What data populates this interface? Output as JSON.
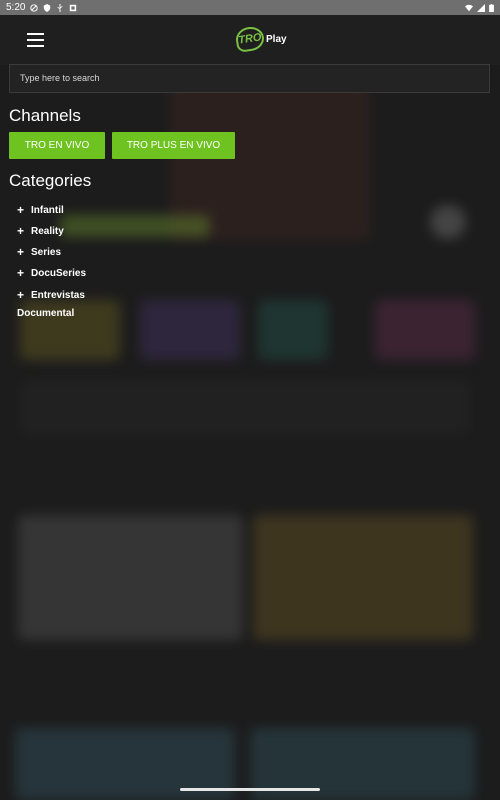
{
  "status_bar": {
    "time": "5:20",
    "icons_left": [
      "do-not-disturb-icon",
      "shield-icon",
      "usb-icon",
      "app-icon"
    ],
    "icons_right": [
      "wifi-icon",
      "signal-icon",
      "battery-icon"
    ]
  },
  "header": {
    "menu_icon": "menu-icon",
    "logo_mark": "TRO",
    "logo_word": "Play"
  },
  "search": {
    "placeholder": "Type here to search"
  },
  "channels": {
    "title": "Channels",
    "buttons": [
      {
        "label": "TRO EN VIVO"
      },
      {
        "label": "TRO PLUS EN VIVO"
      }
    ]
  },
  "categories": {
    "title": "Categories",
    "items": [
      {
        "label": "Infantil",
        "expandable": true
      },
      {
        "label": "Reality",
        "expandable": true
      },
      {
        "label": "Series",
        "expandable": true
      },
      {
        "label": "DocuSeries",
        "expandable": true
      },
      {
        "label": "Entrevistas",
        "expandable": true
      },
      {
        "label": "Documental",
        "expandable": false
      }
    ]
  },
  "colors": {
    "accent": "#6fc320",
    "logo_green": "#7ac143",
    "background": "#1c1c1c"
  }
}
